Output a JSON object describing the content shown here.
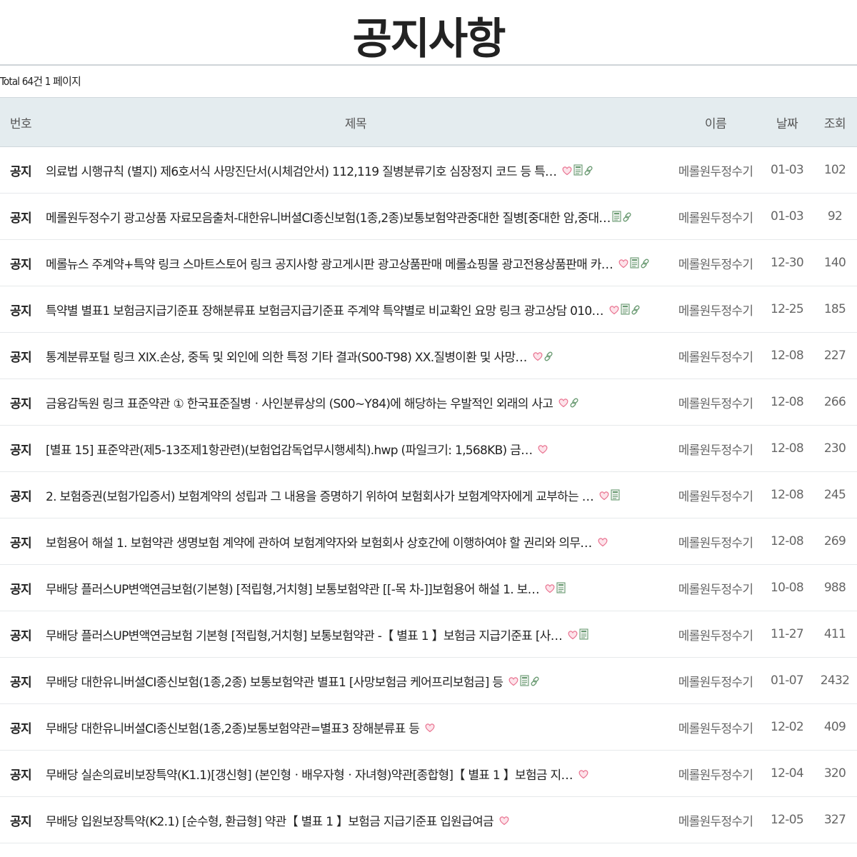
{
  "page": {
    "title": "공지사항",
    "total_text": "Total 64건 1 페이지"
  },
  "columns": {
    "num": "번호",
    "subject": "제목",
    "name": "이름",
    "date": "날짜",
    "hit": "조회"
  },
  "colors": {
    "header_bg": "#e4ecef",
    "heart": "#e8718f",
    "icon_green": "#6a9a72"
  },
  "posts": [
    {
      "num": "공지",
      "subject": "의료법 시행규칙 (별지) 제6호서식 사망진단서(시체검안서) 112,119 질병분류기호 심장정지 코드 등 특…",
      "icons": [
        "heart-icon",
        "file-icon",
        "link-icon"
      ],
      "name": "메롤원두정수기",
      "date": "01-03",
      "hit": "102"
    },
    {
      "num": "공지",
      "subject": "메롤원두정수기 광고상품 자료모음출처-대한유니버셜CI종신보험(1종,2종)보통보험약관중대한 질병[중대한 암,중대…",
      "icons": [
        "file-icon",
        "link-icon"
      ],
      "name": "메롤원두정수기",
      "date": "01-03",
      "hit": "92"
    },
    {
      "num": "공지",
      "subject": "메롤뉴스 주계약+특약 링크 스마트스토어 링크 공지사항 광고게시판 광고상품판매 메롤쇼핑몰 광고전용상품판매 카…",
      "icons": [
        "heart-icon",
        "file-icon",
        "link-icon"
      ],
      "name": "메롤원두정수기",
      "date": "12-30",
      "hit": "140"
    },
    {
      "num": "공지",
      "subject": "특약별 별표1 보험금지급기준표 장해분류표 보험금지급기준표 주계약 특약별로 비교확인 요망 링크 광고상담 010…",
      "icons": [
        "heart-icon",
        "file-icon",
        "link-icon"
      ],
      "name": "메롤원두정수기",
      "date": "12-25",
      "hit": "185"
    },
    {
      "num": "공지",
      "subject": "통계분류포털 링크 ⅩⅨ.손상, 중독 및 외인에 의한 특정 기타 결과(S00-T98) ⅩⅩ.질병이환 및 사망…",
      "icons": [
        "heart-icon",
        "link-icon"
      ],
      "name": "메롤원두정수기",
      "date": "12-08",
      "hit": "227"
    },
    {
      "num": "공지",
      "subject": "금융감독원 링크 표준약관 ① 한국표준질병ㆍ사인분류상의 (S00~Y84)에 해당하는 우발적인 외래의 사고",
      "icons": [
        "heart-icon",
        "link-icon"
      ],
      "name": "메롤원두정수기",
      "date": "12-08",
      "hit": "266"
    },
    {
      "num": "공지",
      "subject": "[별표 15] 표준약관(제5-13조제1항관련)(보험업감독업무시행세칙).hwp (파일크기: 1,568KB) 금…",
      "icons": [
        "heart-icon"
      ],
      "name": "메롤원두정수기",
      "date": "12-08",
      "hit": "230"
    },
    {
      "num": "공지",
      "subject": "2. 보험증권(보험가입증서) 보험계약의 성립과 그 내용을 증명하기 위하여 보험회사가 보험계약자에게 교부하는 …",
      "icons": [
        "heart-icon",
        "file-icon"
      ],
      "name": "메롤원두정수기",
      "date": "12-08",
      "hit": "245"
    },
    {
      "num": "공지",
      "subject": "보험용어 해설 1. 보험약관 생명보험 계약에 관하여 보험계약자와 보험회사 상호간에 이행하여야 할 권리와 의무…",
      "icons": [
        "heart-icon"
      ],
      "name": "메롤원두정수기",
      "date": "12-08",
      "hit": "269"
    },
    {
      "num": "공지",
      "subject": "무배당 플러스UP변액연금보험(기본형) [적립형,거치형] 보통보험약관 [[-목 차-]]보험용어 해설 1. 보…",
      "icons": [
        "heart-icon",
        "file-icon"
      ],
      "name": "메롤원두정수기",
      "date": "10-08",
      "hit": "988"
    },
    {
      "num": "공지",
      "subject": "무배당 플러스UP변액연금보험 기본형 [적립형,거치형] 보통보험약관 -【 별표 1 】보험금 지급기준표 [사…",
      "icons": [
        "heart-icon",
        "file-icon"
      ],
      "name": "메롤원두정수기",
      "date": "11-27",
      "hit": "411"
    },
    {
      "num": "공지",
      "subject": "무배당 대한유니버셜CI종신보험(1종,2종) 보통보험약관 별표1 [사망보험금 케어프리보험금] 등",
      "icons": [
        "heart-icon",
        "file-icon",
        "link-icon"
      ],
      "name": "메롤원두정수기",
      "date": "01-07",
      "hit": "2432"
    },
    {
      "num": "공지",
      "subject": "무배당 대한유니버셜CI종신보험(1종,2종)보통보험약관=별표3 장해분류표 등",
      "icons": [
        "heart-icon"
      ],
      "name": "메롤원두정수기",
      "date": "12-02",
      "hit": "409"
    },
    {
      "num": "공지",
      "subject": "무배당 실손의료비보장특약(K1.1)[갱신형] (본인형ㆍ배우자형ㆍ자녀형)약관[종합형]【 별표 1 】보험금 지…",
      "icons": [
        "heart-icon"
      ],
      "name": "메롤원두정수기",
      "date": "12-04",
      "hit": "320"
    },
    {
      "num": "공지",
      "subject": "무배당 입원보장특약(K2.1) [순수형, 환급형] 약관【 별표 1 】보험금 지급기준표 입원급여금",
      "icons": [
        "heart-icon"
      ],
      "name": "메롤원두정수기",
      "date": "12-05",
      "hit": "327"
    }
  ]
}
